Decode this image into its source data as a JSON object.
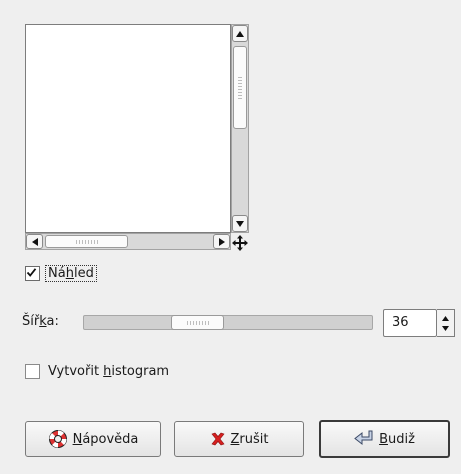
{
  "preview": {
    "checkbox_checked": true,
    "label_pre": "Ná",
    "label_u": "h",
    "label_post": "led"
  },
  "width": {
    "label_pre": "Šíř",
    "label_u": "k",
    "label_post": "a:",
    "value": "36",
    "slider_fraction": 0.35
  },
  "histogram": {
    "checkbox_checked": false,
    "label_pre": "Vytvořit ",
    "label_u": "h",
    "label_post": "istogram"
  },
  "buttons": {
    "help": {
      "u": "N",
      "rest": "ápověda",
      "icon": "lifebuoy-icon"
    },
    "cancel": {
      "u": "Z",
      "rest": "rušit",
      "icon": "red-x-icon"
    },
    "ok": {
      "u": "B",
      "rest": "udiž",
      "icon": "enter-arrow-icon"
    }
  }
}
